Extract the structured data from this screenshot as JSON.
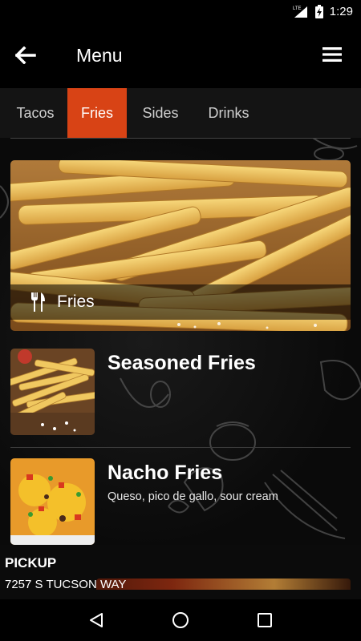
{
  "status_bar": {
    "network": "LTE",
    "time": "1:29"
  },
  "header": {
    "title": "Menu",
    "back_icon": "arrow-back-icon",
    "menu_icon": "hamburger-icon"
  },
  "tabs": [
    {
      "label": "Tacos",
      "active": false
    },
    {
      "label": "Fries",
      "active": true
    },
    {
      "label": "Sides",
      "active": false
    },
    {
      "label": "Drinks",
      "active": false
    }
  ],
  "colors": {
    "accent": "#d84315",
    "background": "#000000"
  },
  "category_hero": {
    "label": "Fries",
    "icon": "utensils-icon"
  },
  "items": [
    {
      "name": "Seasoned Fries",
      "description": ""
    },
    {
      "name": "Nacho Fries",
      "description": "Queso, pico de gallo, sour cream"
    }
  ],
  "pickup": {
    "label": "PICKUP",
    "address": "7257 S TUCSON WAY"
  },
  "nav": {
    "back": "nav-back-icon",
    "home": "nav-home-icon",
    "recents": "nav-recents-icon"
  }
}
